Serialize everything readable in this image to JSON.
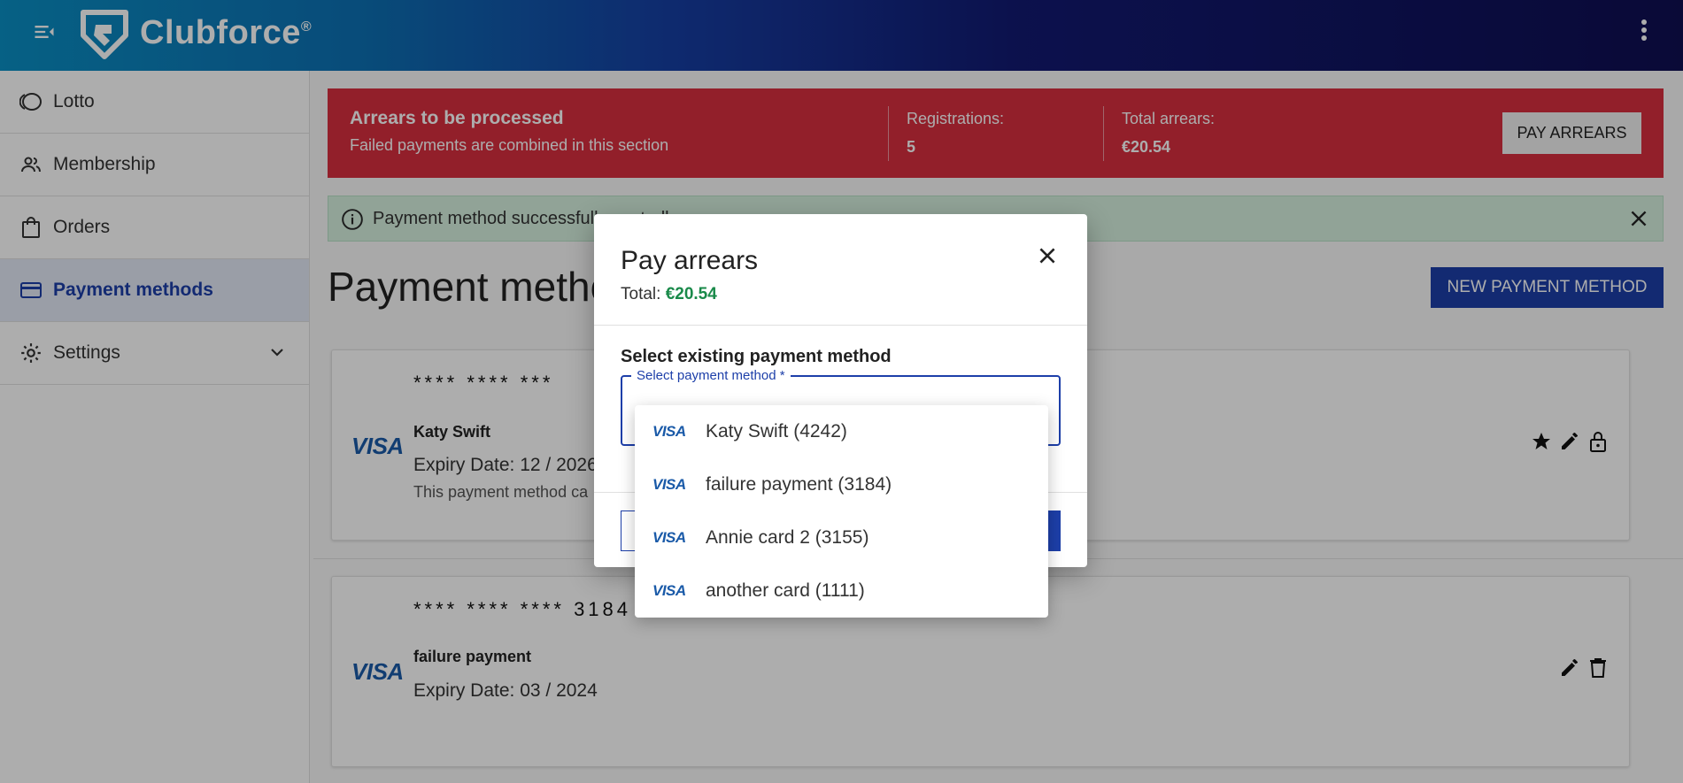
{
  "header": {
    "brand": "Clubforce",
    "brand_mark": "®"
  },
  "sidebar": {
    "items": [
      {
        "label": "Lotto",
        "icon": "lotto-icon",
        "active": false
      },
      {
        "label": "Membership",
        "icon": "people-icon",
        "active": false
      },
      {
        "label": "Orders",
        "icon": "shopping-bag-icon",
        "active": false
      },
      {
        "label": "Payment methods",
        "icon": "credit-card-icon",
        "active": true
      },
      {
        "label": "Settings",
        "icon": "gear-icon",
        "active": false
      }
    ]
  },
  "arrears": {
    "title": "Arrears to be processed",
    "subtitle": "Failed payments are combined in this section",
    "registrations_label": "Registrations:",
    "registrations_value": "5",
    "total_label": "Total arrears:",
    "total_value": "€20.54",
    "button_label": "PAY ARREARS"
  },
  "alert": {
    "text": "Payment method successfully controlle"
  },
  "page": {
    "title": "Payment metho",
    "new_button_label": "NEW PAYMENT METHOD"
  },
  "cards": [
    {
      "brand": "VISA",
      "number": "**** **** ***",
      "name": "Katy Swift",
      "expiry": "Expiry Date: 12 / 2026",
      "note": "This payment method ca"
    },
    {
      "brand": "VISA",
      "number": "**** **** ****  3184",
      "name": "failure payment",
      "expiry": "Expiry Date: 03 / 2024",
      "note": ""
    }
  ],
  "dialog": {
    "title": "Pay arrears",
    "total_label": "Total:",
    "total_value": "€20.54",
    "section_title": "Select existing payment method",
    "select_label": "Select payment method *"
  },
  "dropdown": {
    "options": [
      {
        "brand": "VISA",
        "label": "Katy Swift (4242)"
      },
      {
        "brand": "VISA",
        "label": "failure payment (3184)"
      },
      {
        "brand": "VISA",
        "label": "Annie card 2 (3155)"
      },
      {
        "brand": "VISA",
        "label": "another card (1111)"
      }
    ]
  },
  "colors": {
    "arrears_bg": "#d82e3e",
    "primary": "#1d3fa9",
    "success_bg": "#d6f0df",
    "total_green": "#1a8a4a"
  }
}
